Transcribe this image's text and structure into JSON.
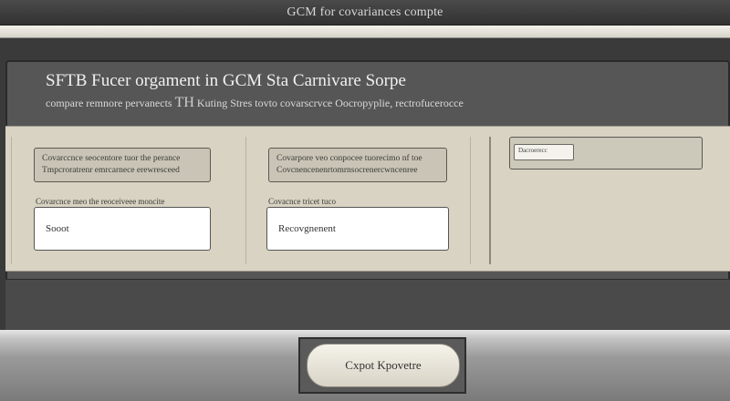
{
  "window": {
    "title": "GCM for covariances compte"
  },
  "header": {
    "heading": "SFTB Fucer orgament in GCM Sta Carnivare Sorpe",
    "subheading_pre": "compare remnore pervanects",
    "subheading_emph": "TH",
    "subheading_post": "Kuting Stres tovto covarscrvce Oocropyplie, rectrofucerocce"
  },
  "form": {
    "left": {
      "notice_line1": "Covarccnce seocentore tuor the perance",
      "notice_line2": "Tmpcroratrenr emrcarnece erewresceed",
      "field_label": "Covarcnce meo the reoceiveee moncite",
      "field_value": "Sooot"
    },
    "middle": {
      "notice_line1": "Covarpore veo conpocee tuorecimo nf toe",
      "notice_line2": "Covcnencenenrtomrnsocrenercwncenree",
      "field_label": "Covacnce tricet tuco",
      "field_value": "Recovgnenent"
    },
    "right": {
      "status_text": "Dacroerecc"
    }
  },
  "actions": {
    "export_label": "Cxpot Kpovetre"
  }
}
